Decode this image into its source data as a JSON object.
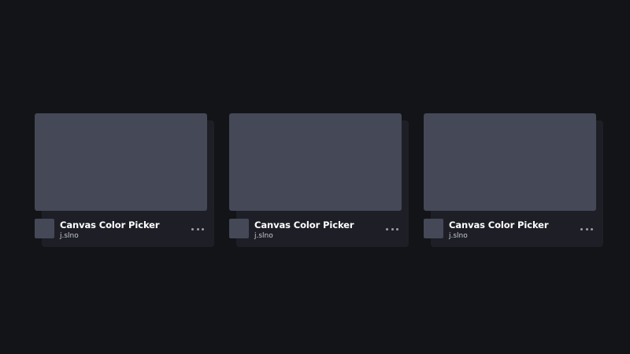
{
  "cards": [
    {
      "title": "Canvas Color Picker",
      "author": "j.slno",
      "menu_icon": "more-dots-icon"
    },
    {
      "title": "Canvas Color Picker",
      "author": "j.slno",
      "menu_icon": "more-dots-icon"
    },
    {
      "title": "Canvas Color Picker",
      "author": "j.slno",
      "menu_icon": "more-dots-icon"
    }
  ],
  "colors": {
    "background": "#131417",
    "card": "#1e1f26",
    "preview": "#444857",
    "title": "#ffffff",
    "author": "#c7c9d3",
    "menu_dots": "#9b9dad"
  }
}
